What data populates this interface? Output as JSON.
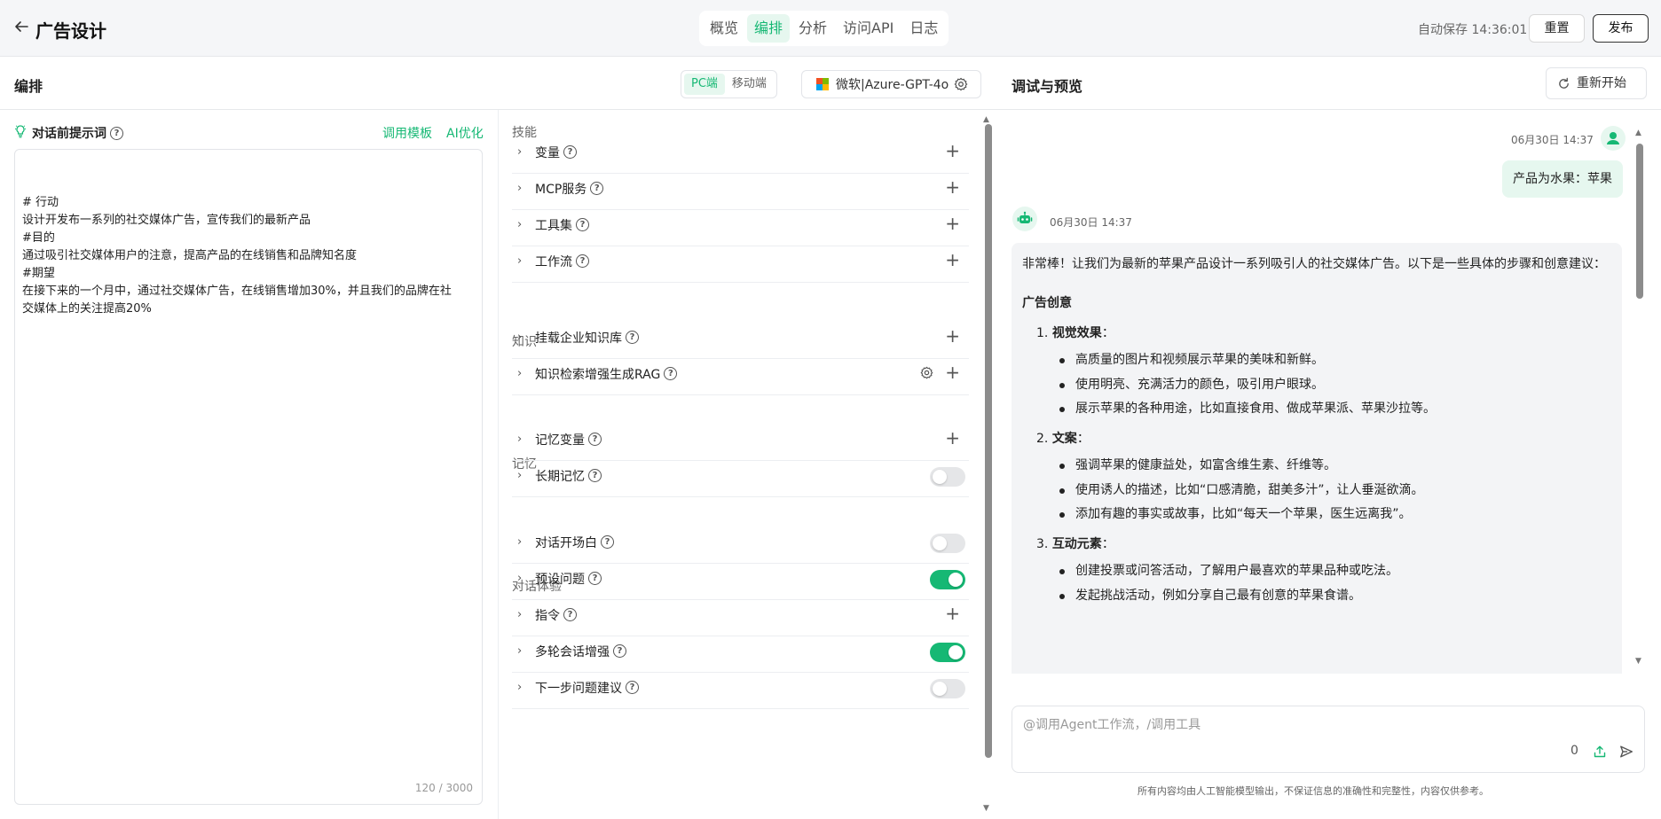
{
  "header": {
    "title": "广告设计",
    "tabs": [
      {
        "label": "概览",
        "active": false
      },
      {
        "label": "编排",
        "active": true
      },
      {
        "label": "分析",
        "active": false
      },
      {
        "label": "访问API",
        "active": false
      },
      {
        "label": "日志",
        "active": false
      }
    ],
    "autosave": "自动保存 14:36:01",
    "reset_label": "重置",
    "publish_label": "发布"
  },
  "editor": {
    "title": "编排",
    "device_tabs": [
      {
        "label": "PC端",
        "active": true
      },
      {
        "label": "移动端",
        "active": false
      }
    ],
    "model": "微软|Azure-GPT-4o",
    "prompt_label": "对话前提示词",
    "template_link": "调用模板",
    "ai_optimize_link": "AI优化",
    "prompt_text": "# 行动\n设计开发布一系列的社交媒体广告，宣传我们的最新产品\n#目的\n通过吸引社交媒体用户的注意，提高产品的在线销售和品牌知名度\n#期望\n在接下来的一个月中，通过社交媒体广告，在线销售增加30%，并且我们的品牌在社\n交媒体上的关注提高20%",
    "char_count": "120 / 3000"
  },
  "skills": {
    "sections": {
      "skills": "技能",
      "knowledge": "知识",
      "memory": "记忆",
      "experience": "对话体验"
    },
    "rows": [
      {
        "label": "变量",
        "control": "plus"
      },
      {
        "label": "MCP服务",
        "control": "plus"
      },
      {
        "label": "工具集",
        "control": "plus"
      },
      {
        "label": "工作流",
        "control": "plus"
      },
      {
        "label": "挂载企业知识库",
        "control": "plus"
      },
      {
        "label": "知识检索增强生成RAG",
        "control": "gear-plus"
      },
      {
        "label": "记忆变量",
        "control": "plus"
      },
      {
        "label": "长期记忆",
        "control": "toggle",
        "on": false
      },
      {
        "label": "对话开场白",
        "control": "toggle",
        "on": false
      },
      {
        "label": "预设问题",
        "control": "toggle",
        "on": true
      },
      {
        "label": "指令",
        "control": "plus"
      },
      {
        "label": "多轮会话增强",
        "control": "toggle",
        "on": true
      },
      {
        "label": "下一步问题建议",
        "control": "toggle",
        "on": false
      }
    ]
  },
  "preview": {
    "title": "调试与预览",
    "restart_label": "重新开始",
    "user_time": "06月30日 14:37",
    "user_message": "产品为水果：苹果",
    "bot_time": "06月30日 14:37",
    "bot_intro": "非常棒！让我们为最新的苹果产品设计一系列吸引人的社交媒体广告。以下是一些具体的步骤和创意建议：",
    "bot_heading": "广告创意",
    "bot_points": [
      {
        "num": "1.",
        "title": "视觉效果",
        "colon": "：",
        "items": [
          "高质量的图片和视频展示苹果的美味和新鲜。",
          "使用明亮、充满活力的颜色，吸引用户眼球。",
          "展示苹果的各种用途，比如直接食用、做成苹果派、苹果沙拉等。"
        ]
      },
      {
        "num": "2.",
        "title": "文案",
        "colon": "：",
        "items": [
          "强调苹果的健康益处，如富含维生素、纤维等。",
          "使用诱人的描述，比如“口感清脆，甜美多汁”，让人垂涎欲滴。",
          "添加有趣的事实或故事，比如“每天一个苹果，医生远离我”。"
        ]
      },
      {
        "num": "3.",
        "title": "互动元素",
        "colon": "：",
        "items": [
          "创建投票或问答活动，了解用户最喜欢的苹果品种或吃法。",
          "发起挑战活动，例如分享自己最有创意的苹果食谱。"
        ]
      }
    ],
    "input_placeholder": "@调用Agent工作流，/调用工具",
    "input_count": "0",
    "disclaimer": "所有内容均由人工智能模型输出，不保证信息的准确性和完整性，内容仅供参考。"
  },
  "colors": {
    "accent": "#16b874",
    "accent_bg": "#e6f7ef"
  },
  "icons": [
    "back-arrow-icon",
    "lightbulb-icon",
    "help-icon",
    "chevron-right-icon",
    "plus-icon",
    "gear-icon",
    "microsoft-logo-icon",
    "restart-icon",
    "user-avatar-icon",
    "bot-avatar-icon",
    "upload-icon",
    "send-icon"
  ]
}
